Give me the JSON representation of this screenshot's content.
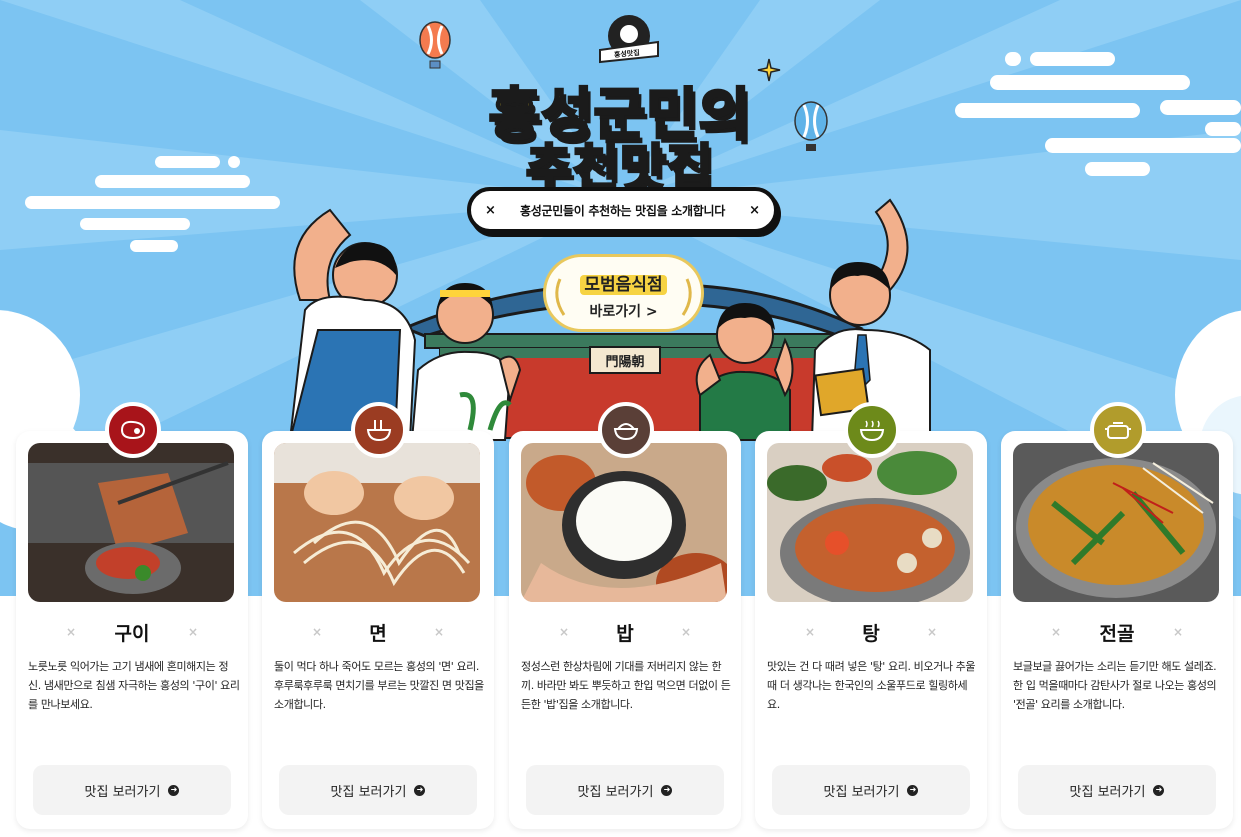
{
  "header": {
    "badge_text": "홍성맛집",
    "title_line1": "홍성군민의",
    "title_line2": "추천맛집",
    "subtitle": "홍성군민들이 추천하는 맛집을 소개합니다",
    "subtitle_deco": "×",
    "gate_sign": "門陽朝"
  },
  "model_restaurant": {
    "title": "모범음식점",
    "link": "바로가기 >"
  },
  "colors": {
    "sky": "#7cc4f2",
    "title_yellow": "#ffdf2e",
    "gui": "#a8141a",
    "myeon": "#9b3c22",
    "bap": "#5a3f37",
    "tang": "#6d8a1a",
    "jeongol": "#b19c2c"
  },
  "cards": [
    {
      "name": "구이",
      "icon": "meat-icon",
      "deco": "×",
      "desc": "노릇노릇 익어가는 고기 냄새에 혼미해지는 정신. 냄새만으로 침샘 자극하는 홍성의 '구이' 요리를 만나보세요.",
      "button": "맛집 보러가기"
    },
    {
      "name": "면",
      "icon": "noodle-bowl-icon",
      "deco": "×",
      "desc": "둘이 먹다 하나 죽어도 모르는 홍성의 '면' 요리. 후루룩후루룩 면치기를 부르는 맛깔진 면 맛집을 소개합니다.",
      "button": "맛집 보러가기"
    },
    {
      "name": "밥",
      "icon": "rice-bowl-icon",
      "deco": "×",
      "desc": "정성스런 한상차림에 기대를 저버리지 않는 한끼. 바라만 봐도 뿌듯하고 한입 먹으면 더없이 든든한 '밥'집을 소개합니다.",
      "button": "맛집 보러가기"
    },
    {
      "name": "탕",
      "icon": "soup-icon",
      "deco": "×",
      "desc": "맛있는 건 다 때려 넣은 '탕' 요리. 비오거나 추울때 더 생각나는 한국인의 소울푸드로 힐링하세요.",
      "button": "맛집 보러가기"
    },
    {
      "name": "전골",
      "icon": "hot-pot-icon",
      "deco": "×",
      "desc": "보글보글 끓어가는 소리는 듣기만 해도 설레죠. 한 입 먹을때마다 감탄사가 절로 나오는 홍성의 '전골' 요리를 소개합니다.",
      "button": "맛집 보러가기"
    }
  ]
}
